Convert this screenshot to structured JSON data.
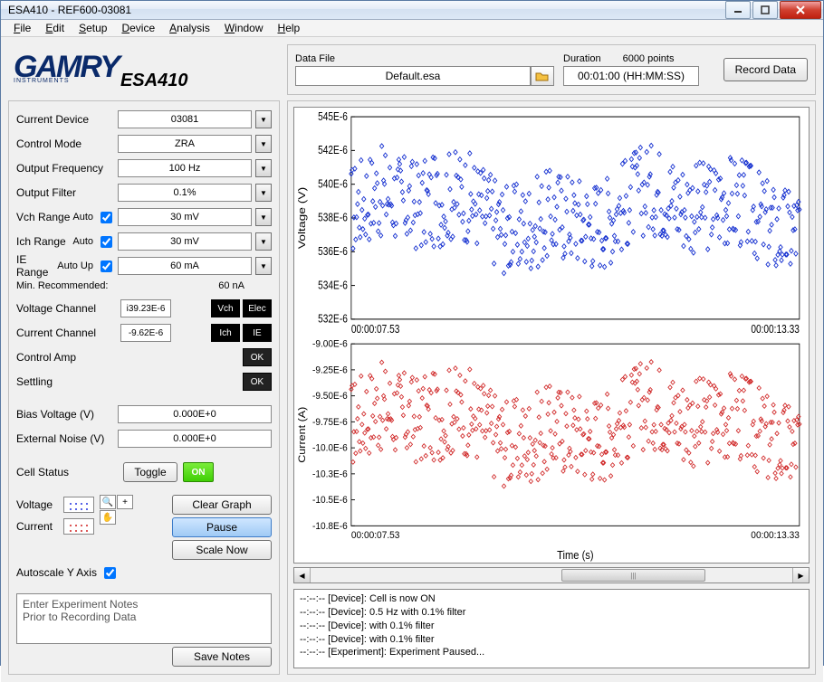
{
  "window": {
    "title": "ESA410 - REF600-03081"
  },
  "menu": [
    "File",
    "Edit",
    "Setup",
    "Device",
    "Analysis",
    "Window",
    "Help"
  ],
  "logo": {
    "brand": "GAMRY",
    "sub": "INSTRUMENTS",
    "suffix": "ESA410"
  },
  "datafile": {
    "label": "Data File",
    "value": "Default.esa"
  },
  "duration": {
    "label": "Duration",
    "value": "00:01:00 (HH:MM:SS)",
    "points": "6000 points"
  },
  "record_btn": "Record Data",
  "params": {
    "current_device": {
      "label": "Current Device",
      "value": "03081"
    },
    "control_mode": {
      "label": "Control Mode",
      "value": "ZRA"
    },
    "output_freq": {
      "label": "Output Frequency",
      "value": "100 Hz"
    },
    "output_filter": {
      "label": "Output Filter",
      "value": "0.1%"
    },
    "vch_range": {
      "label": "Vch Range",
      "aux": "Auto",
      "value": "30 mV"
    },
    "ich_range": {
      "label": "Ich Range",
      "aux": "Auto",
      "value": "30 mV"
    },
    "ie_range": {
      "label": "IE Range",
      "aux": "Auto Up",
      "value": "60 mA"
    },
    "min_recommended": {
      "label": "Min. Recommended:",
      "value": "60 nA"
    },
    "voltage_channel": {
      "label": "Voltage Channel",
      "value": "i39.23E-6",
      "btn1": "Vch",
      "btn2": "Elec"
    },
    "current_channel": {
      "label": "Current Channel",
      "value": "-9.62E-6",
      "btn1": "Ich",
      "btn2": "IE"
    },
    "control_amp": {
      "label": "Control Amp",
      "btn": "OK"
    },
    "settling": {
      "label": "Settling",
      "btn": "OK"
    },
    "bias_voltage": {
      "label": "Bias Voltage (V)",
      "value": "0.000E+0"
    },
    "external_noise": {
      "label": "External Noise (V)",
      "value": "0.000E+0"
    },
    "cell_status": {
      "label": "Cell Status",
      "toggle": "Toggle",
      "state": "ON"
    }
  },
  "legend": {
    "voltage": "Voltage",
    "current": "Current",
    "autoscale": "Autoscale Y Axis"
  },
  "actions": {
    "clear": "Clear Graph",
    "pause": "Pause",
    "scale": "Scale Now"
  },
  "notes": {
    "placeholder": "Enter Experiment Notes\nPrior to Recording Data",
    "save": "Save Notes"
  },
  "log": [
    "--:--:-- [Device]: Cell is now ON",
    "--:--:-- [Device]: 0.5 Hz with 0.1% filter",
    "--:--:-- [Device]:  with 0.1% filter",
    "--:--:-- [Device]:  with 0.1% filter",
    "--:--:-- [Experiment]: Experiment Paused..."
  ],
  "chart_data": [
    {
      "type": "scatter",
      "title": "",
      "xlabel": "Time (s)",
      "ylabel": "Voltage (V)",
      "ylim": [
        0.000532,
        0.000545
      ],
      "yticks": [
        "532E-6",
        "534E-6",
        "536E-6",
        "538E-6",
        "540E-6",
        "542E-6",
        "545E-6"
      ],
      "xlim": [
        7.53,
        13.33
      ],
      "xticks": [
        "00:00:07.53",
        "00:00:13.33"
      ],
      "color": "#1530d0",
      "n_points": 500,
      "mean": 0.000539,
      "spread": 3e-06
    },
    {
      "type": "scatter",
      "title": "",
      "xlabel": "Time (s)",
      "ylabel": "Current (A)",
      "ylim": [
        -1.08e-05,
        -9e-06
      ],
      "yticks": [
        "-10.8E-6",
        "-10.5E-6",
        "-10.3E-6",
        "-10.0E-6",
        "-9.75E-6",
        "-9.50E-6",
        "-9.25E-6",
        "-9.00E-6"
      ],
      "xlim": [
        7.53,
        13.33
      ],
      "xticks": [
        "00:00:07.53",
        "00:00:13.33"
      ],
      "color": "#d02828",
      "n_points": 500,
      "mean": -9.8e-06,
      "spread": 4.5e-07
    }
  ]
}
